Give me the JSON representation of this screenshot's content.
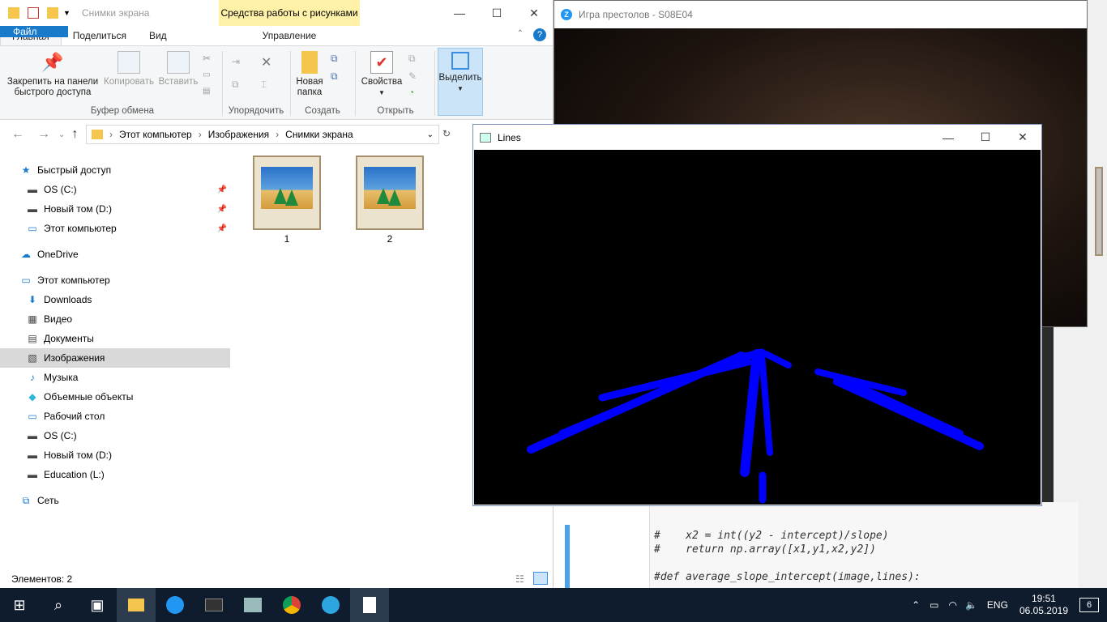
{
  "explorer": {
    "window_title": "Снимки экрана",
    "context_tab": "Средства работы с рисунками",
    "tabs": [
      "Файл",
      "Главная",
      "Поделиться",
      "Вид",
      "Управление"
    ],
    "ribbon": {
      "pin": "Закрепить на панели быстрого доступа",
      "pin_l1": "Закрепить на панели",
      "pin_l2": "быстрого доступа",
      "copy": "Копировать",
      "paste": "Вставить",
      "new_folder_l1": "Новая",
      "new_folder_l2": "папка",
      "properties": "Свойства",
      "select": "Выделить",
      "groups": [
        "Буфер обмена",
        "Упорядочить",
        "Создать",
        "Открыть"
      ]
    },
    "address": [
      "Этот компьютер",
      "Изображения",
      "Снимки экрана"
    ],
    "nav": [
      {
        "label": "Быстрый доступ",
        "icon": "star-icon",
        "level": 0,
        "pinned": false
      },
      {
        "label": "OS (C:)",
        "icon": "drive-icon",
        "level": 1,
        "pinned": true
      },
      {
        "label": "Новый том (D:)",
        "icon": "drive-icon",
        "level": 1,
        "pinned": true
      },
      {
        "label": "Этот компьютер",
        "icon": "computer-icon",
        "level": 1,
        "pinned": true
      },
      {
        "label": "OneDrive",
        "icon": "cloud-icon",
        "level": 0,
        "pinned": false
      },
      {
        "label": "Этот компьютер",
        "icon": "computer-icon",
        "level": 0,
        "pinned": false
      },
      {
        "label": "Downloads",
        "icon": "download-icon",
        "level": 1,
        "pinned": false
      },
      {
        "label": "Видео",
        "icon": "video-icon",
        "level": 1,
        "pinned": false
      },
      {
        "label": "Документы",
        "icon": "document-icon",
        "level": 1,
        "pinned": false
      },
      {
        "label": "Изображения",
        "icon": "pictures-icon",
        "level": 1,
        "pinned": false,
        "selected": true
      },
      {
        "label": "Музыка",
        "icon": "music-icon",
        "level": 1,
        "pinned": false
      },
      {
        "label": "Объемные объекты",
        "icon": "cube-icon",
        "level": 1,
        "pinned": false
      },
      {
        "label": "Рабочий стол",
        "icon": "desktop-icon",
        "level": 1,
        "pinned": false
      },
      {
        "label": "OS (C:)",
        "icon": "drive-icon",
        "level": 1,
        "pinned": false
      },
      {
        "label": "Новый том (D:)",
        "icon": "drive-icon",
        "level": 1,
        "pinned": false
      },
      {
        "label": "Education (L:)",
        "icon": "drive-icon",
        "level": 1,
        "pinned": false
      },
      {
        "label": "Сеть",
        "icon": "network-icon",
        "level": 0,
        "pinned": false
      }
    ],
    "files": [
      "1",
      "2"
    ],
    "status": "Элементов: 2"
  },
  "video": {
    "title": "Игра престолов - S08E04"
  },
  "lines_window": {
    "title": "Lines",
    "line_color": "#0000ff",
    "background": "#000000"
  },
  "code_lines": [
    "#    x2 = int((y2 - intercept)/slope)",
    "#    return np.array([x1,y1,x2,y2])",
    "",
    "#def average_slope_intercept(image,lines):"
  ],
  "taskbar": {
    "lang": "ENG",
    "time": "19:51",
    "date": "06.05.2019",
    "notifications": "6"
  }
}
